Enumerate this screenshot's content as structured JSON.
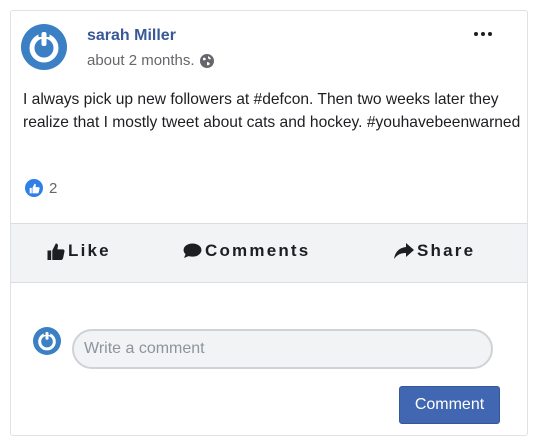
{
  "post": {
    "author": "sarah Miller",
    "timestamp": "about 2 months.",
    "visibility_icon": "globe-icon",
    "text": "I always pick up new followers at #defcon. Then two weeks later they realize that I mostly tweet about cats and hockey. #youhavebeenwarned",
    "reaction_icon": "like-icon",
    "reaction_count": "2"
  },
  "actions": {
    "like_label": "Like",
    "comments_label": "Comments",
    "share_label": "Share"
  },
  "comment_box": {
    "placeholder": "Write a comment",
    "value": "",
    "submit_label": "Comment"
  },
  "colors": {
    "accent": "#385898",
    "button": "#4267b2",
    "avatar": "#3b7fc4",
    "reaction": "#2f7fe6"
  }
}
